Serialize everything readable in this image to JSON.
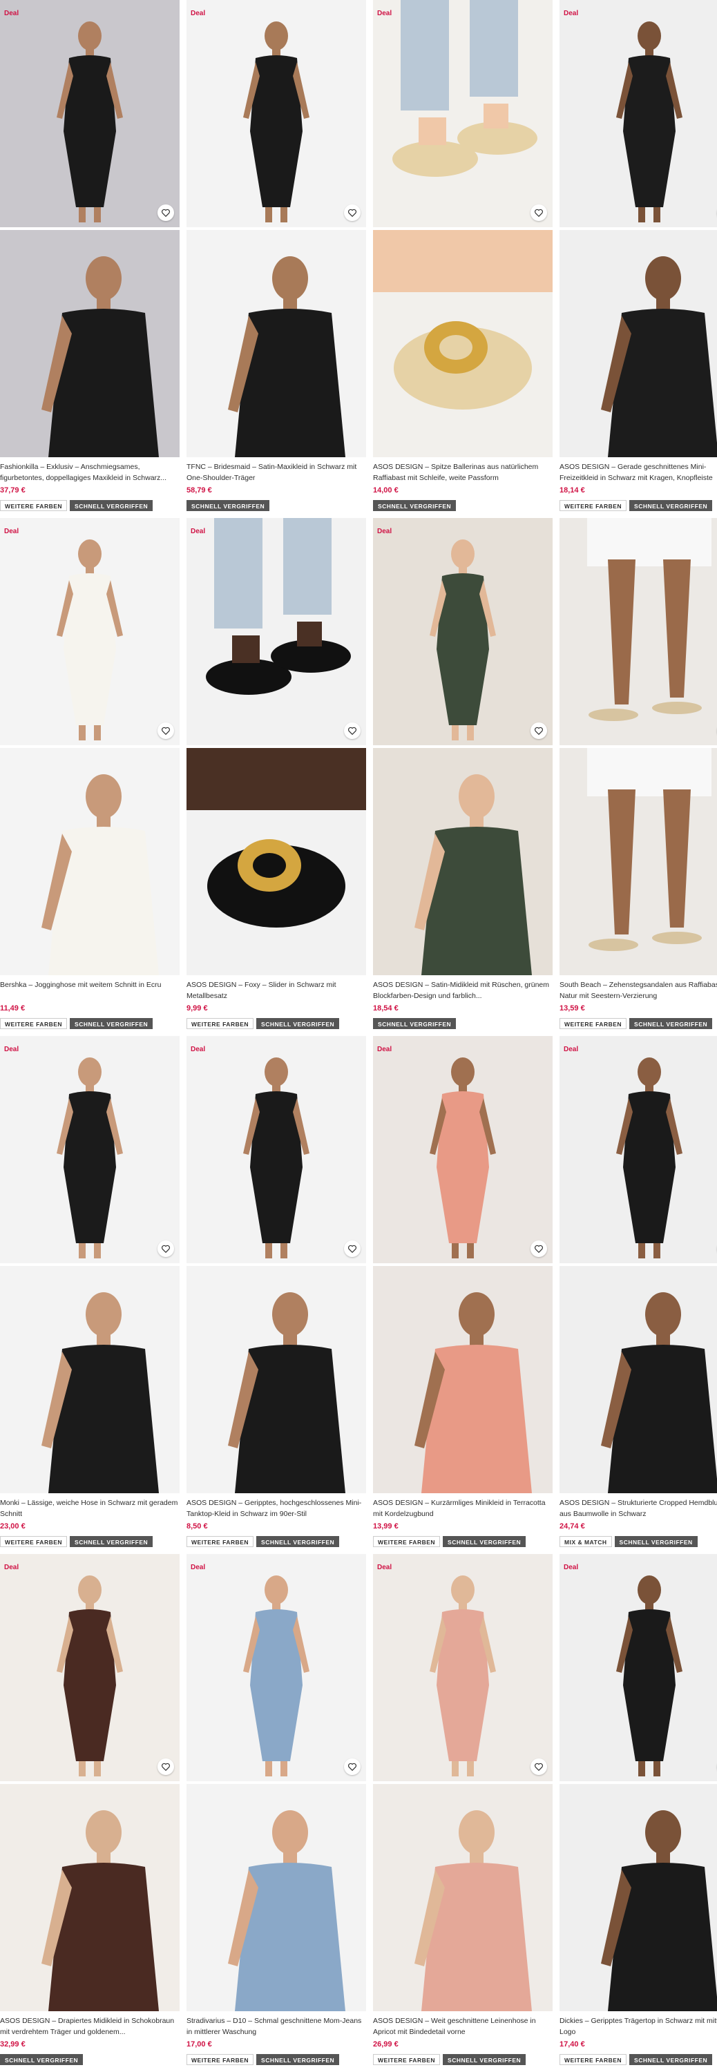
{
  "colors": {
    "price": "#d01345",
    "deal": "#d01345",
    "badge_dark": "#555555"
  },
  "deal_label": "Deal",
  "badge_labels": {
    "more_colors": "WEITERE FARBEN",
    "quick_sold": "SCHNELL VERGRIFFEN",
    "mix_match": "MIX & MATCH"
  },
  "products": [
    {
      "title": "Fashionkilla – Exklusiv – Anschmiegsames, figurbetontes, doppellagiges Maxikleid in Schwarz...",
      "price": "37,79 €",
      "deal": true,
      "badges": [
        "WEITERE FARBEN",
        "SCHNELL VERGRIFFEN"
      ]
    },
    {
      "title": "TFNC – Bridesmaid – Satin-Maxikleid in Schwarz mit One-Shoulder-Träger",
      "price": "58,79 €",
      "deal": true,
      "badges": [
        "SCHNELL VERGRIFFEN"
      ]
    },
    {
      "title": "ASOS DESIGN – Spitze Ballerinas aus natürlichem Raffiabast mit Schleife, weite Passform",
      "price": "14,00 €",
      "deal": true,
      "badges": [
        "SCHNELL VERGRIFFEN"
      ]
    },
    {
      "title": "ASOS DESIGN – Gerade geschnittenes Mini-Freizeitkleid in Schwarz mit Kragen, Knopfleiste",
      "price": "18,14 €",
      "deal": true,
      "badges": [
        "WEITERE FARBEN",
        "SCHNELL VERGRIFFEN"
      ]
    },
    {
      "title": "Bershka – Jogginghose mit weitem Schnitt in Ecru",
      "price": "11,49 €",
      "deal": true,
      "badges": [
        "WEITERE FARBEN",
        "SCHNELL VERGRIFFEN"
      ]
    },
    {
      "title": "ASOS DESIGN – Foxy – Slider in Schwarz mit Metallbesatz",
      "price": "9,99 €",
      "deal": true,
      "badges": [
        "WEITERE FARBEN",
        "SCHNELL VERGRIFFEN"
      ]
    },
    {
      "title": "ASOS DESIGN – Satin-Midikleid mit Rüschen, grünem Blockfarben-Design und farblich...",
      "price": "18,54 €",
      "deal": true,
      "badges": [
        "SCHNELL VERGRIFFEN"
      ]
    },
    {
      "title": "South Beach – Zehenstegsandalen aus Raffiabast in Natur mit Seestern-Verzierung",
      "price": "13,59 €",
      "deal": false,
      "badges": [
        "WEITERE FARBEN",
        "SCHNELL VERGRIFFEN"
      ]
    },
    {
      "title": "Monki – Lässige, weiche Hose in Schwarz mit geradem Schnitt",
      "price": "23,00 €",
      "deal": true,
      "badges": [
        "WEITERE FARBEN",
        "SCHNELL VERGRIFFEN"
      ]
    },
    {
      "title": "ASOS DESIGN – Geripptes, hochgeschlossenes Mini-Tanktop-Kleid in Schwarz im 90er-Stil",
      "price": "8,50 €",
      "deal": true,
      "badges": [
        "WEITERE FARBEN",
        "SCHNELL VERGRIFFEN"
      ]
    },
    {
      "title": "ASOS DESIGN – Kurzärmliges Minikleid in Terracotta mit Kordelzugbund",
      "price": "13,99 €",
      "deal": true,
      "badges": [
        "WEITERE FARBEN",
        "SCHNELL VERGRIFFEN"
      ]
    },
    {
      "title": "ASOS DESIGN – Strukturierte Cropped Hemdbluse aus Baumwolle in Schwarz",
      "price": "24,74 €",
      "deal": true,
      "badges": [
        "MIX & MATCH",
        "SCHNELL VERGRIFFEN"
      ]
    },
    {
      "title": "ASOS DESIGN – Drapiertes Midikleid in Schokobraun mit verdrehtem Träger und goldenem...",
      "price": "32,99 €",
      "deal": true,
      "badges": [
        "SCHNELL VERGRIFFEN"
      ]
    },
    {
      "title": "Stradivarius – D10 – Schmal geschnittene Mom-Jeans in mittlerer Waschung",
      "price": "17,00 €",
      "deal": true,
      "badges": [
        "WEITERE FARBEN",
        "SCHNELL VERGRIFFEN"
      ]
    },
    {
      "title": "ASOS DESIGN – Weit geschnittene Leinenhose in Apricot mit Bindedetail vorne",
      "price": "26,99 €",
      "deal": true,
      "badges": [
        "WEITERE FARBEN",
        "SCHNELL VERGRIFFEN"
      ]
    },
    {
      "title": "Dickies – Geripptes Trägertop in Schwarz mit mittigem Logo",
      "price": "17,40 €",
      "deal": true,
      "badges": [
        "WEITERE FARBEN",
        "SCHNELL VERGRIFFEN"
      ]
    }
  ],
  "images": [
    {
      "bg": "#c9c7cc",
      "fg": "#1a1a1a",
      "skin": "#b08060",
      "kind": "figure"
    },
    {
      "bg": "#f3f3f3",
      "fg": "#1a1a1a",
      "skin": "#a87a58",
      "kind": "figure"
    },
    {
      "bg": "#f2f0ec",
      "fg": "#e6d2a6",
      "skin": "#f0c8a8",
      "kind": "shoes"
    },
    {
      "bg": "#efefef",
      "fg": "#1c1c1c",
      "skin": "#7a5238",
      "kind": "figure"
    },
    {
      "bg": "#f4f4f4",
      "fg": "#f6f4ee",
      "skin": "#c89a7a",
      "kind": "figure"
    },
    {
      "bg": "#f2f2f2",
      "fg": "#111111",
      "skin": "#4a3024",
      "kind": "shoes"
    },
    {
      "bg": "#e6e0d8",
      "fg": "#3d4b3a",
      "skin": "#e2b898",
      "kind": "figure"
    },
    {
      "bg": "#ece9e5",
      "fg": "#d7c4a0",
      "skin": "#9a6a4a",
      "kind": "legs"
    },
    {
      "bg": "#f3f3f3",
      "fg": "#1b1b1b",
      "skin": "#c89a7a",
      "kind": "figure"
    },
    {
      "bg": "#f3f3f3",
      "fg": "#1a1a1a",
      "skin": "#b08060",
      "kind": "figure"
    },
    {
      "bg": "#ebe6e2",
      "fg": "#e89a86",
      "skin": "#a07050",
      "kind": "figure"
    },
    {
      "bg": "#efefef",
      "fg": "#1a1a1a",
      "skin": "#8a5e42",
      "kind": "figure"
    },
    {
      "bg": "#f1ede8",
      "fg": "#4a2a22",
      "skin": "#d8b090",
      "kind": "figure"
    },
    {
      "bg": "#f3f3f3",
      "fg": "#8aa8c8",
      "skin": "#d8a888",
      "kind": "figure"
    },
    {
      "bg": "#efebe7",
      "fg": "#e4a898",
      "skin": "#e0b898",
      "kind": "figure"
    },
    {
      "bg": "#efefef",
      "fg": "#1a1a1a",
      "skin": "#7a5238",
      "kind": "figure"
    }
  ]
}
